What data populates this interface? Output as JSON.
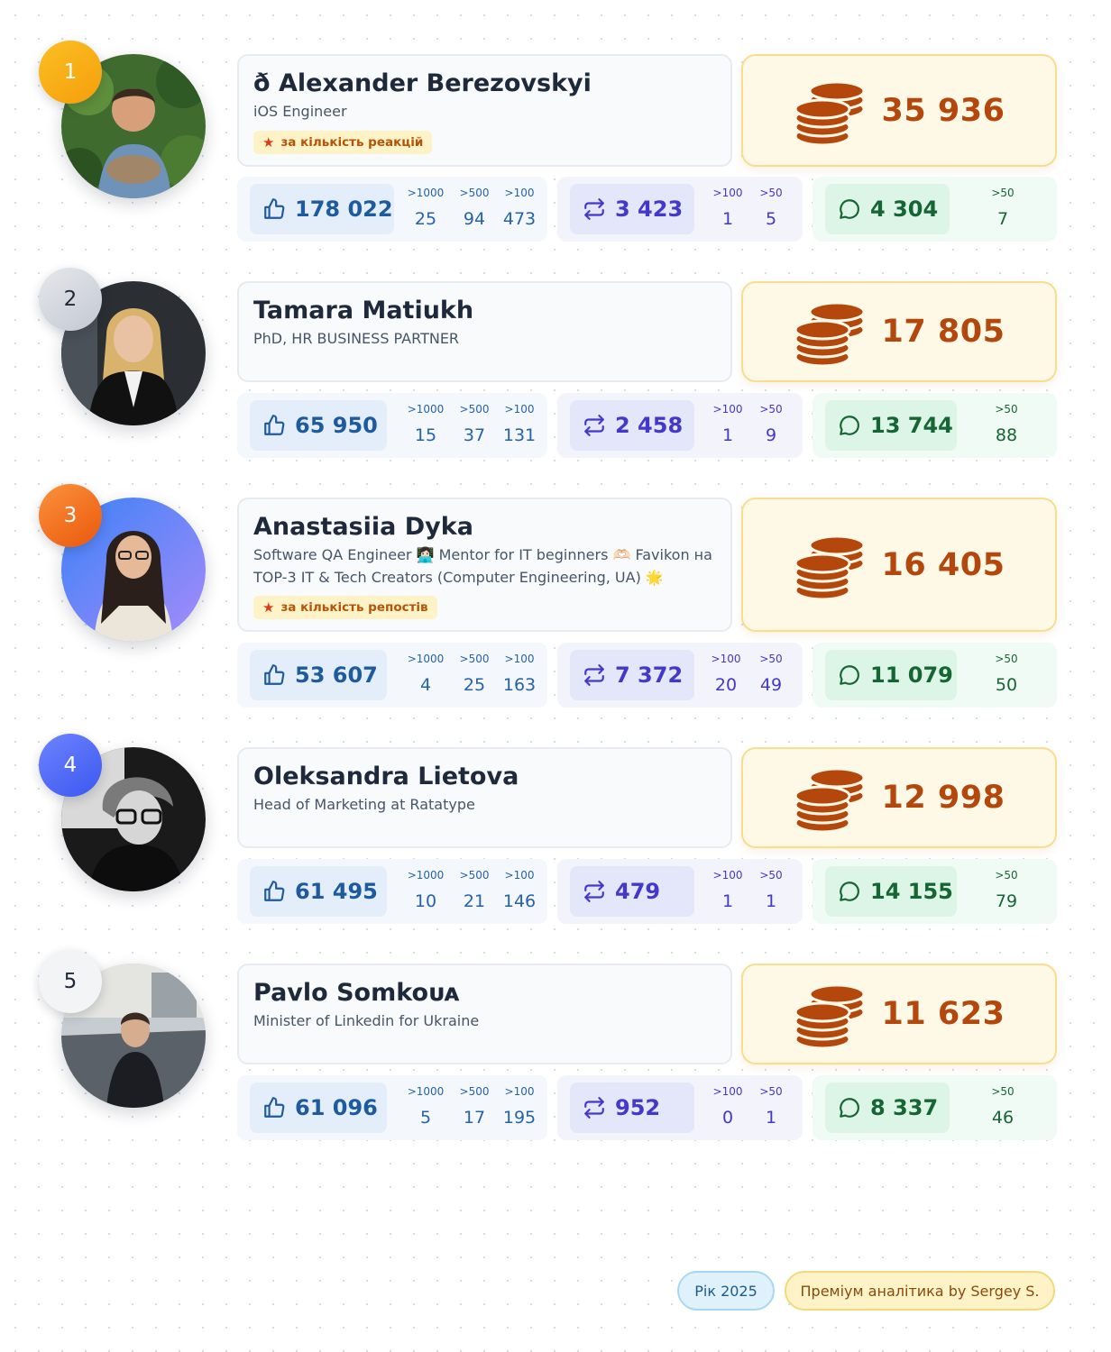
{
  "entries": [
    {
      "rank": "1",
      "name": "ð Alexander Berezovskyi",
      "title_lines": [
        "iOS Engineer"
      ],
      "award": "за кількість реакцій",
      "coins": "35 936",
      "likes": {
        "total": "178 022",
        "thresholds": [
          {
            "label": ">1000",
            "value": "25"
          },
          {
            "label": ">500",
            "value": "94"
          },
          {
            "label": ">100",
            "value": "473"
          }
        ]
      },
      "reposts": {
        "total": "3 423",
        "thresholds": [
          {
            "label": ">100",
            "value": "1"
          },
          {
            "label": ">50",
            "value": "5"
          }
        ]
      },
      "comments": {
        "total": "4 304",
        "thresholds": [
          {
            "label": ">50",
            "value": "7"
          }
        ]
      }
    },
    {
      "rank": "2",
      "name": "Tamara Matiukh",
      "title_lines": [
        "PhD, HR BUSINESS PARTNER"
      ],
      "award": "",
      "coins": "17 805",
      "likes": {
        "total": "65 950",
        "thresholds": [
          {
            "label": ">1000",
            "value": "15"
          },
          {
            "label": ">500",
            "value": "37"
          },
          {
            "label": ">100",
            "value": "131"
          }
        ]
      },
      "reposts": {
        "total": "2 458",
        "thresholds": [
          {
            "label": ">100",
            "value": "1"
          },
          {
            "label": ">50",
            "value": "9"
          }
        ]
      },
      "comments": {
        "total": "13 744",
        "thresholds": [
          {
            "label": ">50",
            "value": "88"
          }
        ]
      }
    },
    {
      "rank": "3",
      "name": "Anastasiia Dyka",
      "title_lines": [
        "Software QA Engineer 👩🏻‍💻 Mentor for IT beginners 🫶🏻 Favikon на",
        "TOP-3 IT & Tech Creators (Computer Engineering, UA) 🌟"
      ],
      "award": "за кількість репостів",
      "coins": "16 405",
      "likes": {
        "total": "53 607",
        "thresholds": [
          {
            "label": ">1000",
            "value": "4"
          },
          {
            "label": ">500",
            "value": "25"
          },
          {
            "label": ">100",
            "value": "163"
          }
        ]
      },
      "reposts": {
        "total": "7 372",
        "thresholds": [
          {
            "label": ">100",
            "value": "20"
          },
          {
            "label": ">50",
            "value": "49"
          }
        ]
      },
      "comments": {
        "total": "11 079",
        "thresholds": [
          {
            "label": ">50",
            "value": "50"
          }
        ]
      }
    },
    {
      "rank": "4",
      "name": "Oleksandra Lietova",
      "title_lines": [
        "Head of Marketing at Ratatype"
      ],
      "award": "",
      "coins": "12 998",
      "likes": {
        "total": "61 495",
        "thresholds": [
          {
            "label": ">1000",
            "value": "10"
          },
          {
            "label": ">500",
            "value": "21"
          },
          {
            "label": ">100",
            "value": "146"
          }
        ]
      },
      "reposts": {
        "total": "479",
        "thresholds": [
          {
            "label": ">100",
            "value": "1"
          },
          {
            "label": ">50",
            "value": "1"
          }
        ]
      },
      "comments": {
        "total": "14 155",
        "thresholds": [
          {
            "label": ">50",
            "value": "79"
          }
        ]
      }
    },
    {
      "rank": "5",
      "name": "Pavlo Somkoᴜᴀ",
      "title_lines": [
        "Minister of Linkedin for Ukraine"
      ],
      "award": "",
      "coins": "11 623",
      "likes": {
        "total": "61 096",
        "thresholds": [
          {
            "label": ">1000",
            "value": "5"
          },
          {
            "label": ">500",
            "value": "17"
          },
          {
            "label": ">100",
            "value": "195"
          }
        ]
      },
      "reposts": {
        "total": "952",
        "thresholds": [
          {
            "label": ">100",
            "value": "0"
          },
          {
            "label": ">50",
            "value": "1"
          }
        ]
      },
      "comments": {
        "total": "8 337",
        "thresholds": [
          {
            "label": ">50",
            "value": "46"
          }
        ]
      }
    }
  ],
  "footer": {
    "year_label": "Рік 2025",
    "brand_label": "Преміум аналітика by Sergey S."
  },
  "colors": {
    "coins": "#b4470c",
    "likes": "#1d5b9e",
    "reposts": "#4338ca",
    "comments": "#166534",
    "award_bg": "#fdf3c7"
  },
  "icons": {
    "likes": "thumbs-up-icon",
    "reposts": "repost-icon",
    "comments": "comment-icon",
    "coins": "coins-stack-icon",
    "award": "star-icon"
  }
}
